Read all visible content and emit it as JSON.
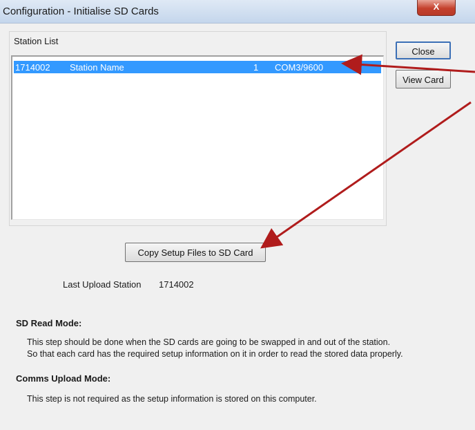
{
  "window": {
    "title": "Configuration - Initialise SD Cards",
    "close_glyph": "X"
  },
  "station_list": {
    "label": "Station List",
    "rows": [
      {
        "id": "1714002",
        "name": "Station Name",
        "num": "1",
        "port": "COM3/9600"
      }
    ]
  },
  "buttons": {
    "close": "Close",
    "view_card": "View Card",
    "copy_setup": "Copy Setup Files to SD Card"
  },
  "last_upload": {
    "label": "Last Upload Station",
    "value": "1714002"
  },
  "sd_read": {
    "heading": "SD Read Mode:",
    "line1": "This step should be done when the SD cards are going to be swapped in and out of the station.",
    "line2": "So that each card has the required setup information on it in order to read the stored data properly."
  },
  "comms_upload": {
    "heading": "Comms Upload Mode:",
    "line1": "This step is not required as the setup information is stored on this computer."
  },
  "colors": {
    "selection": "#3399ff",
    "annotation_arrow": "#b01c1c"
  }
}
